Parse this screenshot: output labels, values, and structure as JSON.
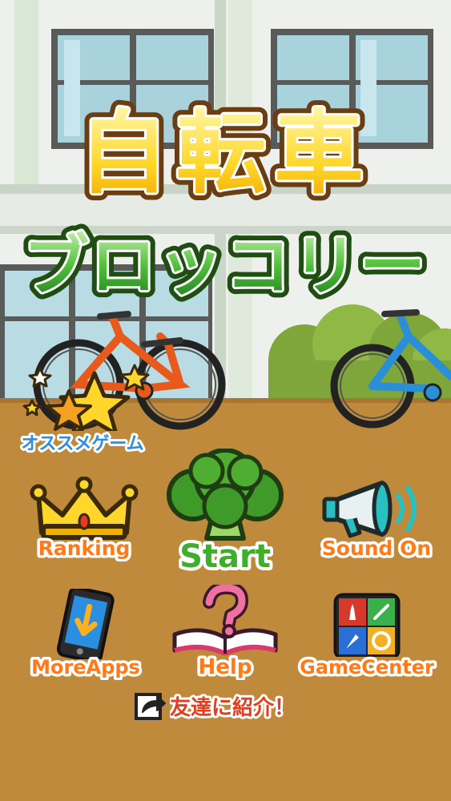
{
  "title": {
    "line1": "自転車",
    "line2": "ブロッコリー"
  },
  "recommend": {
    "label": "オススメゲーム",
    "icon": "star-icon"
  },
  "menu": {
    "ranking": {
      "label": "Ranking",
      "icon": "crown-icon"
    },
    "start": {
      "label": "Start",
      "icon": "broccoli-icon"
    },
    "sound": {
      "label": "Sound On",
      "icon": "megaphone-icon"
    },
    "moreapps": {
      "label": "MoreApps",
      "icon": "phone-download-icon"
    },
    "help": {
      "label": "Help",
      "icon": "question-book-icon"
    },
    "gamecenter": {
      "label": "GameCenter",
      "icon": "gamecenter-icon"
    }
  },
  "share": {
    "label": "友達に紹介！",
    "icon": "share-arrow-icon"
  },
  "colors": {
    "ground": "#bf8a3c",
    "label_orange": "#ff7a1a",
    "start_green": "#3fae2a",
    "title_green": "#2f8f2a",
    "title_yellow": "#ffd62a"
  }
}
